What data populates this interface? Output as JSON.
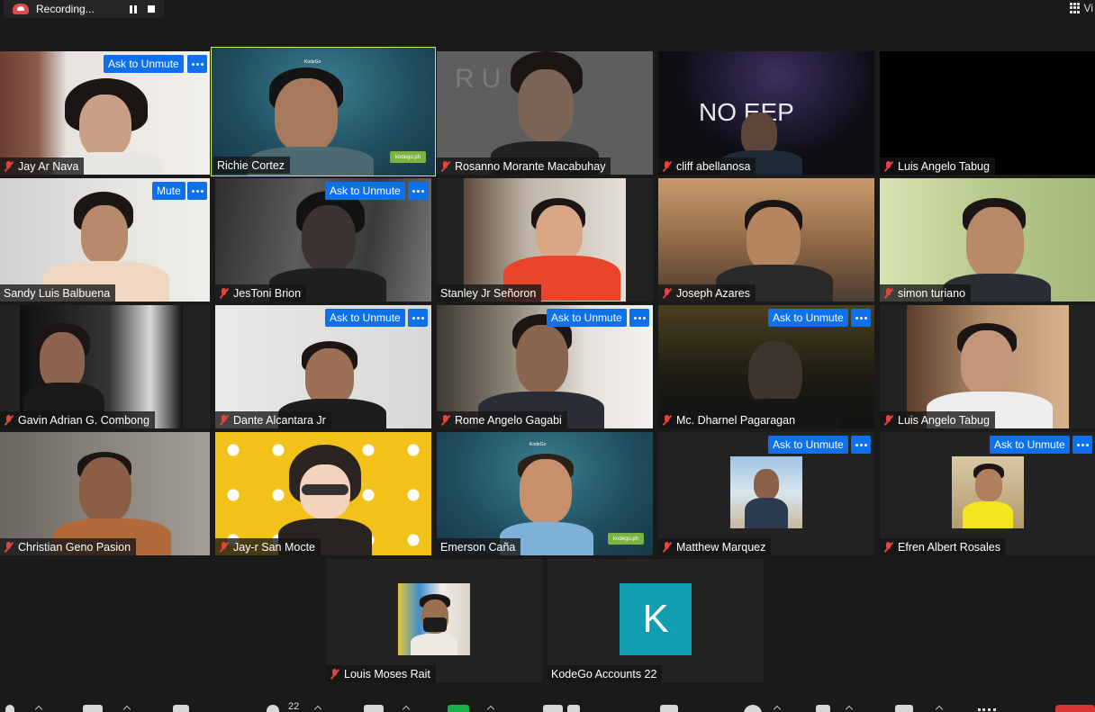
{
  "recording": {
    "label": "Recording..."
  },
  "view": {
    "label": "Vi"
  },
  "tiles": [
    {
      "name": "Jay Ar Nava",
      "action": "Ask to Unmute"
    },
    {
      "name": "Richie Cortez"
    },
    {
      "name": "Rosanno Morante Macabuhay",
      "backdrop_text": "RU      NG"
    },
    {
      "name": "cliff abellanosa",
      "backdrop_text": "NO  EEP"
    },
    {
      "name": "Luis Angelo Tabug"
    },
    {
      "name": "Sandy Luis Balbuena",
      "action": "Mute"
    },
    {
      "name": "JesToni Brion",
      "action": "Ask to Unmute"
    },
    {
      "name": "Stanley Jr Señoron"
    },
    {
      "name": "Joseph Azares"
    },
    {
      "name": "simon turiano"
    },
    {
      "name": "Gavin Adrian G.  Combong"
    },
    {
      "name": "Dante Alcantara Jr",
      "action": "Ask to Unmute"
    },
    {
      "name": "Rome Angelo Gagabi",
      "action": "Ask to Unmute"
    },
    {
      "name": "Mc. Dharnel Pagaragan",
      "action": "Ask to Unmute"
    },
    {
      "name": "Luis Angelo Tabug"
    },
    {
      "name": "Christian Geno Pasion"
    },
    {
      "name": "Jay-r San Mocte"
    },
    {
      "name": "Emerson Caña"
    },
    {
      "name": "Matthew Marquez",
      "action": "Ask to Unmute"
    },
    {
      "name": "Efren Albert Rosales",
      "action": "Ask to Unmute"
    },
    {
      "name": "Louis Moses Rait"
    },
    {
      "name": "KodeGo Accounts 22",
      "avatar_letter": "K"
    }
  ],
  "kodego_logo": "KodeGo",
  "kodego_url": "kodego.ph",
  "toolbar": {
    "participants_count": "22"
  },
  "colors": {
    "active_speaker": "#d5ea64",
    "button_blue": "#0e71eb",
    "muted_red": "#e0453f",
    "avatar_teal": "#0f9fb1"
  }
}
